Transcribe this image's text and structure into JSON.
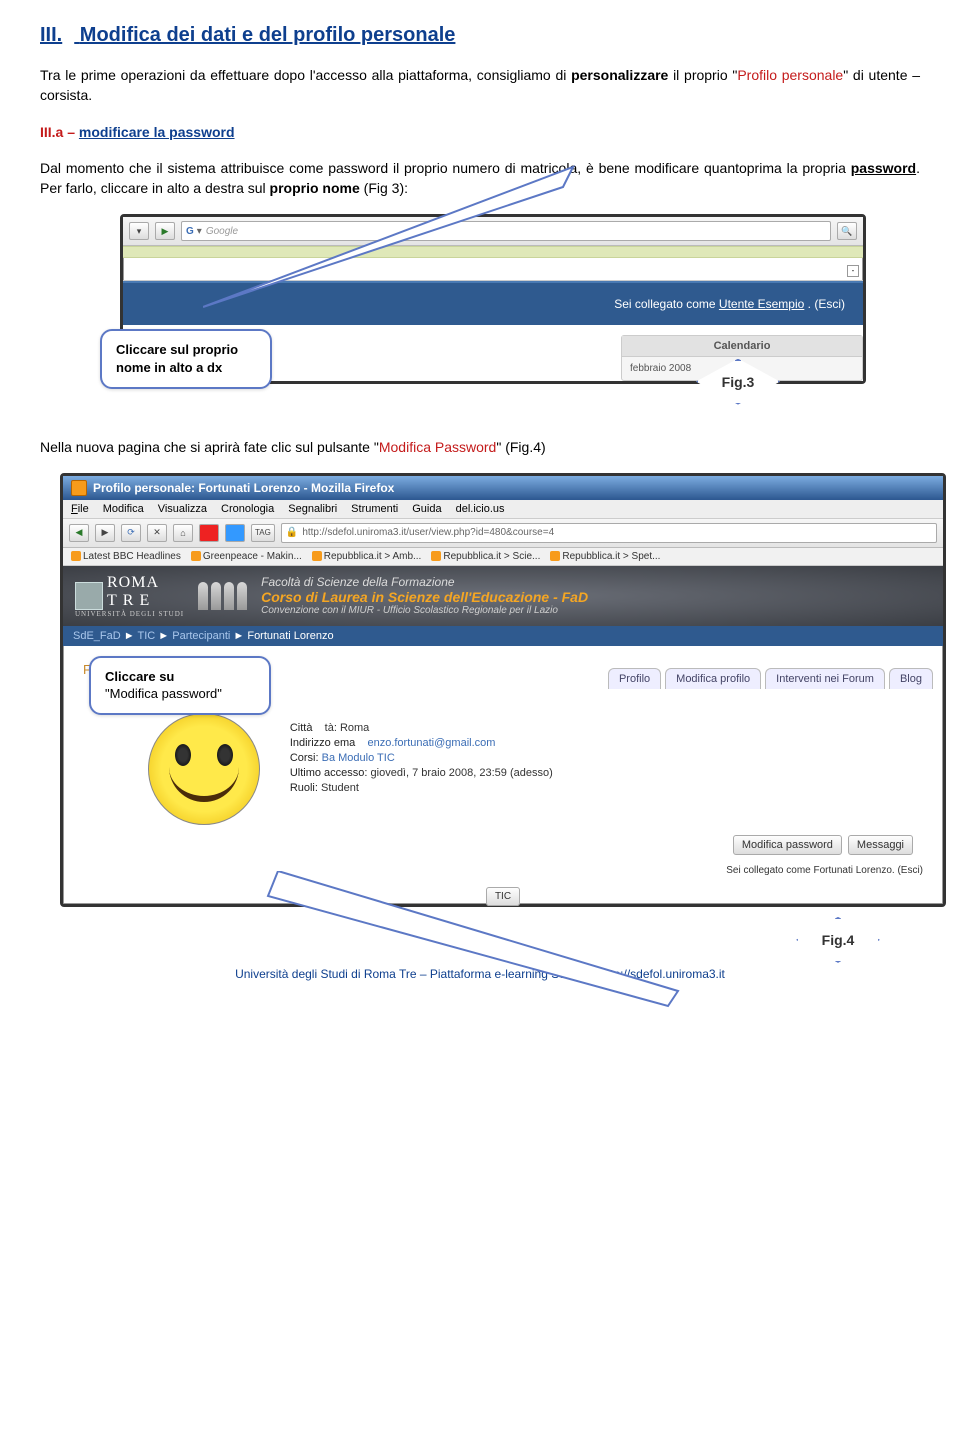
{
  "section": {
    "number": "III.",
    "title": "Modifica dei dati e del profilo personale"
  },
  "intro": {
    "pre": "Tra le prime operazioni da effettuare dopo l'accesso alla piattaforma, consigliamo di ",
    "em1": "personalizzare",
    "mid": " il proprio \"",
    "em2": "Profilo personale",
    "post": "\" di utente – corsista."
  },
  "sub": {
    "num": "III.a –",
    "title": "modificare la password"
  },
  "para1": {
    "pre": "Dal momento che il sistema attribuisce come password il proprio numero di matricola, è bene modificare quantoprima la propria ",
    "u": "password",
    "post": ". Per farlo, cliccare in alto a destra sul ",
    "b": "proprio nome",
    "tail": " (Fig 3):"
  },
  "fig3": {
    "search_engine": "Google",
    "login_pre": "Sei collegato come ",
    "login_user": "Utente Esempio",
    "login_post": " . (Esci)",
    "box_title": "Calendario",
    "box_sub": "febbraio 2008"
  },
  "callout1": "Cliccare sul proprio nome in alto a dx",
  "figlabel3": "Fig.3",
  "para2": {
    "pre": "Nella nuova pagina che si aprirà fate clic sul pulsante \"",
    "em": "Modifica Password",
    "post": "\" (Fig.4)"
  },
  "fig4": {
    "title": "Profilo personale: Fortunati Lorenzo - Mozilla Firefox",
    "menu": {
      "file": "File",
      "modifica": "Modifica",
      "visualizza": "Visualizza",
      "cronologia": "Cronologia",
      "segnalibri": "Segnalibri",
      "strumenti": "Strumenti",
      "guida": "Guida",
      "del": "del.icio.us"
    },
    "url": "http://sdefol.uniroma3.it/user/view.php?id=480&course=4",
    "tag": "TAG",
    "bookmarks": {
      "b1": "Latest BBC Headlines",
      "b2": "Greenpeace - Makin...",
      "b3": "Repubblica.it > Amb...",
      "b4": "Repubblica.it > Scie...",
      "b5": "Repubblica.it > Spet..."
    },
    "logo": {
      "l1": "ROMA",
      "l2": "TRE",
      "sub": "UNIVERSITÀ DEGLI STUDI"
    },
    "hero": {
      "l1": "Facoltà di Scienze della Formazione",
      "l2": "Corso di Laurea in Scienze dell'Educazione - FaD",
      "l3": "Convenzione con il MIUR - Ufficio Scolastico Regionale per il Lazio"
    },
    "crumb": {
      "c1": "SdE_FaD",
      "c2": "TIC",
      "c3": "Partecipanti",
      "c4": "Fortunati Lorenzo"
    },
    "fortuna_label": "Fortuna",
    "tabs": {
      "t1": "Profilo",
      "t2": "Modifica profilo",
      "t3": "Interventi nei Forum",
      "t4": "Blog"
    },
    "profile": {
      "citta_lbl": "Città",
      "citta_val": "tà: Roma",
      "email_lbl": "Indirizzo ema",
      "email_val": "enzo.fortunati@gmail.com",
      "corsi_lbl": "Corsi:",
      "corsi_val": "Ba       Modulo TIC",
      "ultimo_lbl": "Ultimo accesso:",
      "ultimo_val": "giovedì, 7     braio 2008, 23:59 (adesso)",
      "ruoli_lbl": "Ruoli:",
      "ruoli_val": "Student"
    },
    "btn1": "Modifica password",
    "btn2": "Messaggi",
    "logged": "Sei collegato come Fortunati Lorenzo. (Esci)",
    "tic": "TIC"
  },
  "callout2": {
    "l1": "Cliccare su",
    "l2": "\"Modifica password\""
  },
  "figlabel4": "Fig.4",
  "footer": "Università degli Studi di Roma Tre – Piattaforma e-learning SdEFOL http://sdefol.uniroma3.it"
}
